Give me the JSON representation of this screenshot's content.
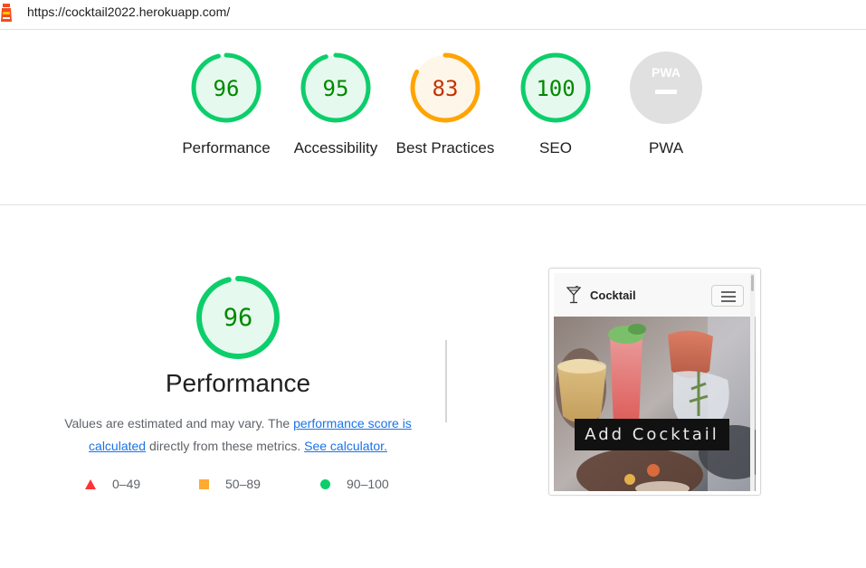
{
  "topbar": {
    "url": "https://cocktail2022.herokuapp.com/",
    "logo_icon": "lighthouse-icon"
  },
  "colors": {
    "pass": "#0cce6b",
    "pass_text": "#008800",
    "pass_bg": "#e6f9ee",
    "average": "#ffa400",
    "average_text": "#c33300",
    "average_bg": "#fff6ea",
    "fail": "#ff3333",
    "na": "#e0e0e0"
  },
  "gauges": [
    {
      "label": "Performance",
      "score": 96,
      "rating": "pass"
    },
    {
      "label": "Accessibility",
      "score": 95,
      "rating": "pass"
    },
    {
      "label": "Best Practices",
      "score": 83,
      "rating": "average"
    },
    {
      "label": "SEO",
      "score": 100,
      "rating": "pass"
    },
    {
      "label": "PWA",
      "score_text": "PWA",
      "rating": "na"
    }
  ],
  "performance": {
    "score": 96,
    "title": "Performance",
    "desc_before": "Values are estimated and may vary. The ",
    "link_score": "performance score is calculated",
    "desc_middle": " directly from these metrics. ",
    "link_calc": "See calculator.",
    "legend": [
      {
        "shape": "triangle",
        "range": "0–49"
      },
      {
        "shape": "square",
        "range": "50–89"
      },
      {
        "shape": "circle",
        "range": "90–100"
      }
    ]
  },
  "screenshot": {
    "brand": "Cocktail",
    "brand_icon": "cocktail-glass-icon",
    "menu_icon": "hamburger-menu-icon",
    "hero_button": "Add Cocktail"
  }
}
